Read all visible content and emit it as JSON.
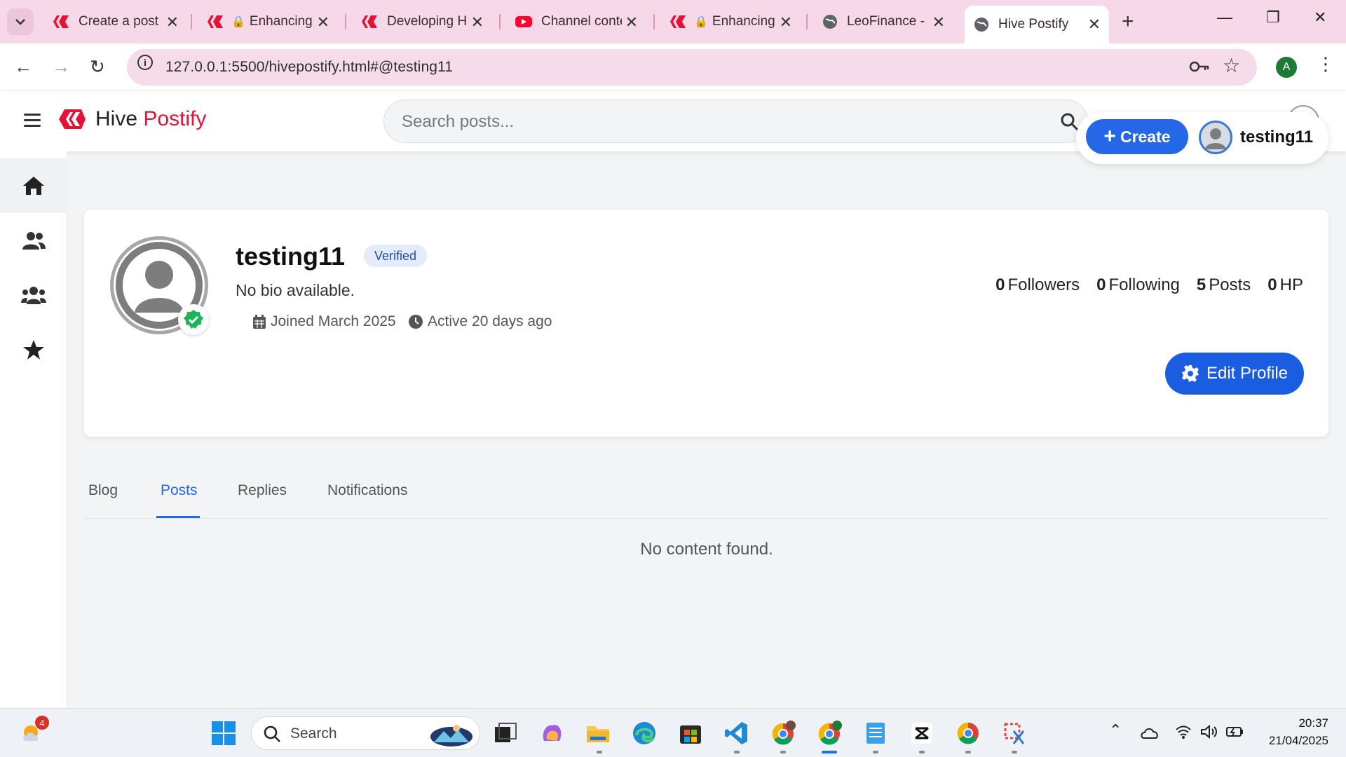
{
  "browser": {
    "tabs": [
      {
        "title": "Create a post",
        "icon": "hive-icon"
      },
      {
        "title": "Enhancing",
        "icon": "hive-icon"
      },
      {
        "title": "Developing Hi",
        "icon": "hive-icon"
      },
      {
        "title": "Channel conte",
        "icon": "youtube-icon"
      },
      {
        "title": "Enhancing",
        "icon": "hive-icon"
      },
      {
        "title": "LeoFinance - I",
        "icon": "globe-icon"
      },
      {
        "title": "Hive Postify",
        "icon": "globe-icon",
        "active": true
      }
    ],
    "url": "127.0.0.1:5500/hivepostify.html#@testing11",
    "profile_initial": "A"
  },
  "app": {
    "brand_prefix": "Hive",
    "brand_accent": "Postify",
    "search_placeholder": "Search posts...",
    "create_label": "Create",
    "username": "testing11"
  },
  "profile": {
    "name": "testing11",
    "verified_label": "Verified",
    "bio": "No bio available.",
    "joined": "Joined March 2025",
    "active": "Active 20 days ago",
    "stats": [
      {
        "value": "0",
        "label": "Followers"
      },
      {
        "value": "0",
        "label": "Following"
      },
      {
        "value": "5",
        "label": "Posts"
      },
      {
        "value": "0",
        "label": "HP"
      }
    ],
    "edit_label": "Edit Profile"
  },
  "tabs": {
    "items": [
      "Blog",
      "Posts",
      "Replies",
      "Notifications"
    ],
    "active": "Posts"
  },
  "content": {
    "empty_message": "No content found."
  },
  "taskbar": {
    "search_label": "Search",
    "weather_badge": "4",
    "time": "20:37",
    "date": "21/04/2025"
  },
  "colors": {
    "brand_red": "#e31337",
    "primary_blue": "#2468e8",
    "tabbar_pink": "#f6d8e8"
  }
}
